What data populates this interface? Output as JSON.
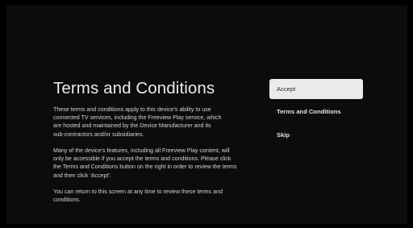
{
  "page": {
    "title": "Terms and Conditions",
    "paragraphs": [
      "These terms and conditions apply to this device's ability to use\nconnected TV services, including the Freeview Play service, which\nare hosted and maintained by the Device Manufacturer and its\nsub-contractors and/or subsidiaries.",
      "Many of the device's features, including all Freeview Play content, will\nonly be accessible if you accept the terms and conditions. Please click\nthe Terms and Conditions button on the right in order to review the terms\nand then click 'Accept'.",
      "You can return to this screen at any time to review these terms and\nconditions."
    ]
  },
  "menu": {
    "items": [
      {
        "label": "Accept",
        "state": "focused"
      },
      {
        "label": "Terms and Conditions",
        "state": "normal"
      },
      {
        "label": "Skip",
        "state": "normal"
      }
    ]
  },
  "colors": {
    "background": "#0c0c0c",
    "focus_background": "#ebebeb",
    "focus_text": "#2a2a2a",
    "text": "#e4e4e4"
  }
}
